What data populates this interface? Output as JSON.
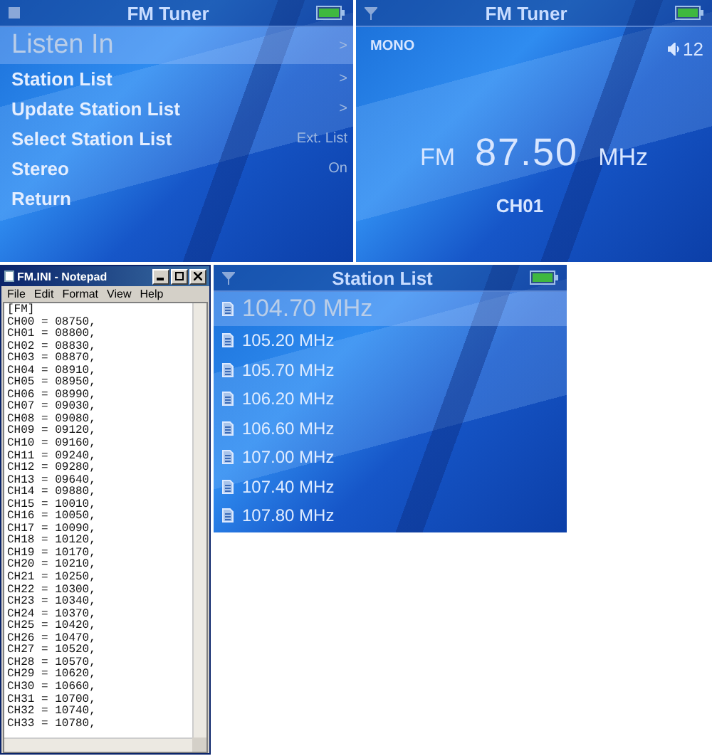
{
  "menu_screen": {
    "title": "FM Tuner",
    "items": [
      {
        "label": "Listen In",
        "trailing": ">",
        "selected": true
      },
      {
        "label": "Station List",
        "trailing": ">",
        "selected": false
      },
      {
        "label": "Update Station List",
        "trailing": ">",
        "selected": false
      },
      {
        "label": "Select Station List",
        "trailing": "Ext. List",
        "selected": false
      },
      {
        "label": "Stereo",
        "trailing": "On",
        "selected": false
      },
      {
        "label": "Return",
        "selected": false
      }
    ]
  },
  "tuner_screen": {
    "title": "FM Tuner",
    "mode": "MONO",
    "volume": "12",
    "band": "FM",
    "frequency": "87.50",
    "unit": "MHz",
    "channel": "CH01"
  },
  "notepad": {
    "title": "FM.INI - Notepad",
    "menu": [
      "File",
      "Edit",
      "Format",
      "View",
      "Help"
    ],
    "lines": [
      "[FM]",
      "CH00 = 08750,",
      "CH01 = 08800,",
      "CH02 = 08830,",
      "CH03 = 08870,",
      "CH04 = 08910,",
      "CH05 = 08950,",
      "CH06 = 08990,",
      "CH07 = 09030,",
      "CH08 = 09080,",
      "CH09 = 09120,",
      "CH10 = 09160,",
      "CH11 = 09240,",
      "CH12 = 09280,",
      "CH13 = 09640,",
      "CH14 = 09880,",
      "CH15 = 10010,",
      "CH16 = 10050,",
      "CH17 = 10090,",
      "CH18 = 10120,",
      "CH19 = 10170,",
      "CH20 = 10210,",
      "CH21 = 10250,",
      "CH22 = 10300,",
      "CH23 = 10340,",
      "CH24 = 10370,",
      "CH25 = 10420,",
      "CH26 = 10470,",
      "CH27 = 10520,",
      "CH28 = 10570,",
      "CH29 = 10620,",
      "CH30 = 10660,",
      "CH31 = 10700,",
      "CH32 = 10740,",
      "CH33 = 10780,"
    ]
  },
  "station_list_screen": {
    "title": "Station List",
    "stations": [
      {
        "label": "104.70 MHz",
        "selected": true
      },
      {
        "label": "105.20 MHz",
        "selected": false
      },
      {
        "label": "105.70 MHz",
        "selected": false
      },
      {
        "label": "106.20 MHz",
        "selected": false
      },
      {
        "label": "106.60 MHz",
        "selected": false
      },
      {
        "label": "107.00 MHz",
        "selected": false
      },
      {
        "label": "107.40 MHz",
        "selected": false
      },
      {
        "label": "107.80 MHz",
        "selected": false
      }
    ]
  }
}
